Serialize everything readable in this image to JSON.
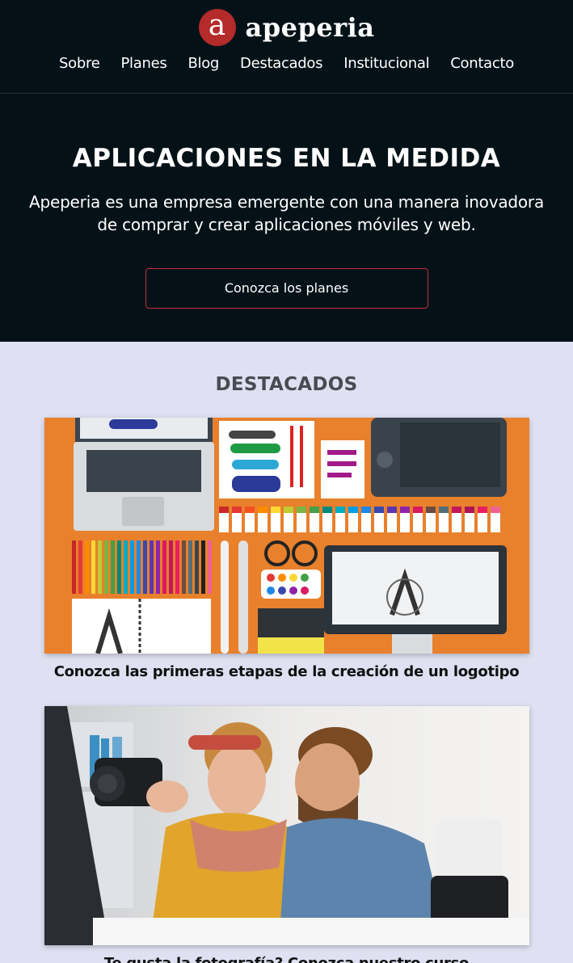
{
  "brand": {
    "logo_letter": "a",
    "name": "apeperia"
  },
  "nav": [
    "Sobre",
    "Planes",
    "Blog",
    "Destacados",
    "Institucional",
    "Contacto"
  ],
  "hero": {
    "title": "APLICACIONES EN LA MEDIDA",
    "text": "Apeperia es una empresa emergente con una manera inovadora de comprar y crear aplicaciones móviles y web.",
    "cta": "Conozca los planes"
  },
  "featured": {
    "heading": "DESTACADOS",
    "posts": [
      {
        "title": "Conozca las primeras etapas de la creación de un logotipo"
      },
      {
        "title": "Te gusta la fotografía? Conozca nuestro curso"
      }
    ]
  },
  "colors": {
    "dark": "#041218",
    "accent": "#b52a2a",
    "section_bg": "#dfe1f2"
  }
}
